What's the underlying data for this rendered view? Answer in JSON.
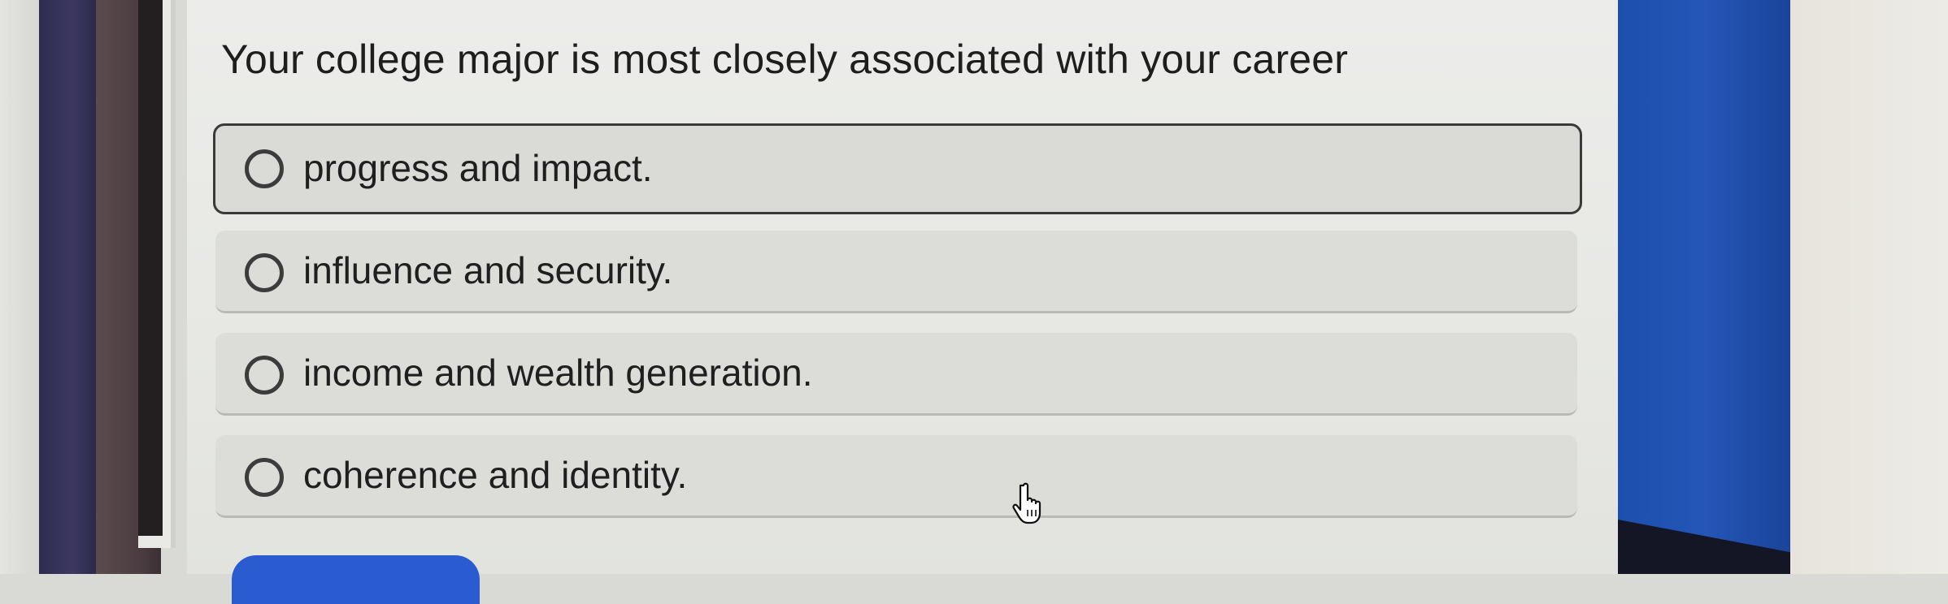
{
  "question": {
    "text": "Your college major is most closely associated with your career"
  },
  "options": [
    {
      "label": "progress and impact.",
      "selected": true
    },
    {
      "label": "influence and security.",
      "selected": false
    },
    {
      "label": "income and wealth generation.",
      "selected": false
    },
    {
      "label": "coherence and identity.",
      "selected": false
    }
  ],
  "colors": {
    "panel_background": "#e9eae6",
    "option_background": "#dcdcd9",
    "accent_blue": "#2456b8",
    "submit_button": "#2a5bd0",
    "text": "#1e1e1e"
  },
  "icons": {
    "radio": "radio-unselected-icon",
    "cursor": "hand-pointer-icon"
  }
}
